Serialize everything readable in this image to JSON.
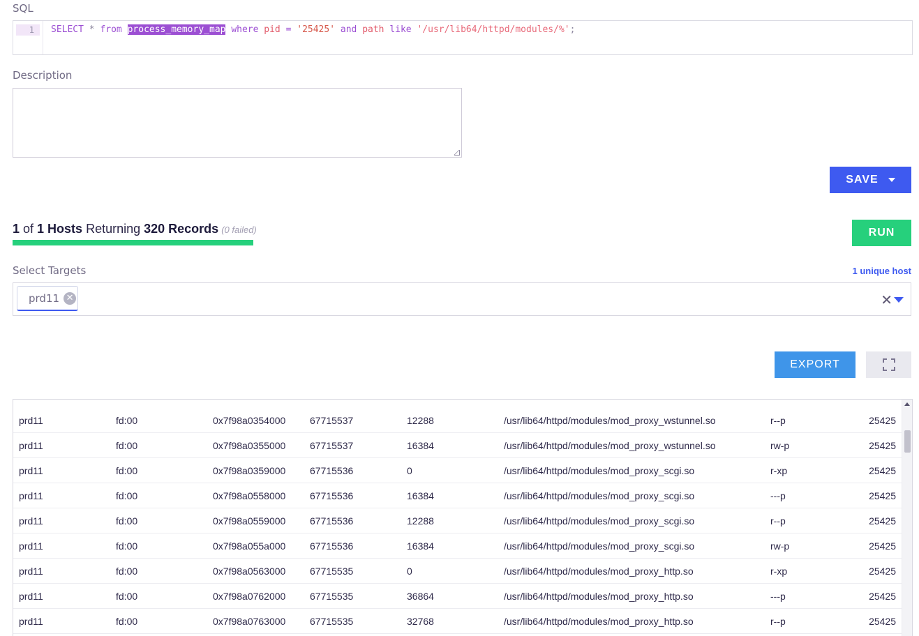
{
  "sql": {
    "label": "SQL",
    "line_number": "1",
    "tokens": {
      "select": "SELECT",
      "star": " * ",
      "from": "from",
      "table": "process_memory_map",
      "where": "where",
      "col_pid": "pid",
      "eq": "=",
      "pid_value": "'25425'",
      "and": "and",
      "col_path": "path",
      "like": "like",
      "path_value": "'/usr/lib64/httpd/modules/%'",
      "semicolon": ";"
    }
  },
  "description": {
    "label": "Description",
    "value": ""
  },
  "buttons": {
    "save": "SAVE",
    "run": "RUN",
    "export": "EXPORT"
  },
  "status": {
    "hosts_done": "1",
    "of_text": " of ",
    "hosts_total": "1 Hosts",
    "returning_text": " Returning ",
    "records": "320 Records",
    "failed": "(0 failed)",
    "progress_fraction": 1.0
  },
  "targets": {
    "label": "Select Targets",
    "unique_hosts": "1 unique host",
    "selected": [
      "prd11"
    ]
  },
  "icons": {
    "save_caret": "caret-down-icon",
    "tag_remove": "close-circle-icon",
    "clear": "clear-icon",
    "dropdown": "caret-down-icon",
    "fullscreen": "fullscreen-icon"
  },
  "colors": {
    "primary": "#3e5af0",
    "success": "#26d07c",
    "export": "#3f95e9",
    "keyword": "#9c4fd3"
  },
  "results": {
    "rows": [
      [
        "prd11",
        "fd:00",
        "0x7f98a0354000",
        "67715537",
        "12288",
        "/usr/lib64/httpd/modules/mod_proxy_wstunnel.so",
        "r--p",
        "25425"
      ],
      [
        "prd11",
        "fd:00",
        "0x7f98a0355000",
        "67715537",
        "16384",
        "/usr/lib64/httpd/modules/mod_proxy_wstunnel.so",
        "rw-p",
        "25425"
      ],
      [
        "prd11",
        "fd:00",
        "0x7f98a0359000",
        "67715536",
        "0",
        "/usr/lib64/httpd/modules/mod_proxy_scgi.so",
        "r-xp",
        "25425"
      ],
      [
        "prd11",
        "fd:00",
        "0x7f98a0558000",
        "67715536",
        "16384",
        "/usr/lib64/httpd/modules/mod_proxy_scgi.so",
        "---p",
        "25425"
      ],
      [
        "prd11",
        "fd:00",
        "0x7f98a0559000",
        "67715536",
        "12288",
        "/usr/lib64/httpd/modules/mod_proxy_scgi.so",
        "r--p",
        "25425"
      ],
      [
        "prd11",
        "fd:00",
        "0x7f98a055a000",
        "67715536",
        "16384",
        "/usr/lib64/httpd/modules/mod_proxy_scgi.so",
        "rw-p",
        "25425"
      ],
      [
        "prd11",
        "fd:00",
        "0x7f98a0563000",
        "67715535",
        "0",
        "/usr/lib64/httpd/modules/mod_proxy_http.so",
        "r-xp",
        "25425"
      ],
      [
        "prd11",
        "fd:00",
        "0x7f98a0762000",
        "67715535",
        "36864",
        "/usr/lib64/httpd/modules/mod_proxy_http.so",
        "---p",
        "25425"
      ],
      [
        "prd11",
        "fd:00",
        "0x7f98a0763000",
        "67715535",
        "32768",
        "/usr/lib64/httpd/modules/mod_proxy_http.so",
        "r--p",
        "25425"
      ]
    ]
  }
}
